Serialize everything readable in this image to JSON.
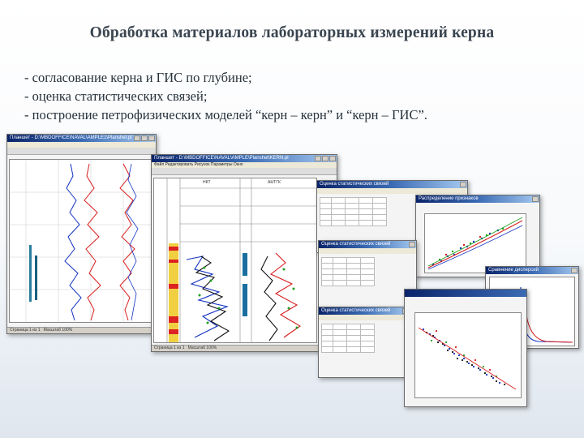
{
  "title": "Обработка материалов лабораторных измерений керна",
  "bullets": [
    "- согласование керна и ГИС по глубине;",
    "- оценка статистических связей;",
    "- построение петрофизических моделей “керн – керн” и “керн – ГИС”."
  ],
  "windows": {
    "w1": {
      "title": "Планшет - D:\\MBDOFFICE\\NAVAL\\AMPLE1\\Planshet.pl",
      "status_left": "Страница 1 из 1",
      "status_right": "Масштаб 100%"
    },
    "w2": {
      "title": "Планшет - D:\\MBDOFFICE\\NAVAL\\AMPLE\\Planshet\\KERN.pl",
      "menu": "Файл  Редактировать  Рисунок  Параметры  Окно",
      "col1": "НКТ",
      "col2": "АК/ГГК",
      "status_left": "Страница 1 из 1",
      "status_right": "Масштаб 100%"
    },
    "w3": {
      "title": "Оценка статистических связей"
    },
    "w4": {
      "title": "Распределение признаков"
    },
    "w5": {
      "title": "Оценка статистических связей"
    },
    "w6": {
      "title": "Сравнение дисперсий"
    },
    "w7": {
      "title": "Оценка статистических связей"
    }
  },
  "colors": {
    "accent_dark": "#0a246a",
    "series_red": "#d81c1c",
    "series_blue": "#1030c0",
    "series_green": "#20a020",
    "series_black": "#111111"
  }
}
